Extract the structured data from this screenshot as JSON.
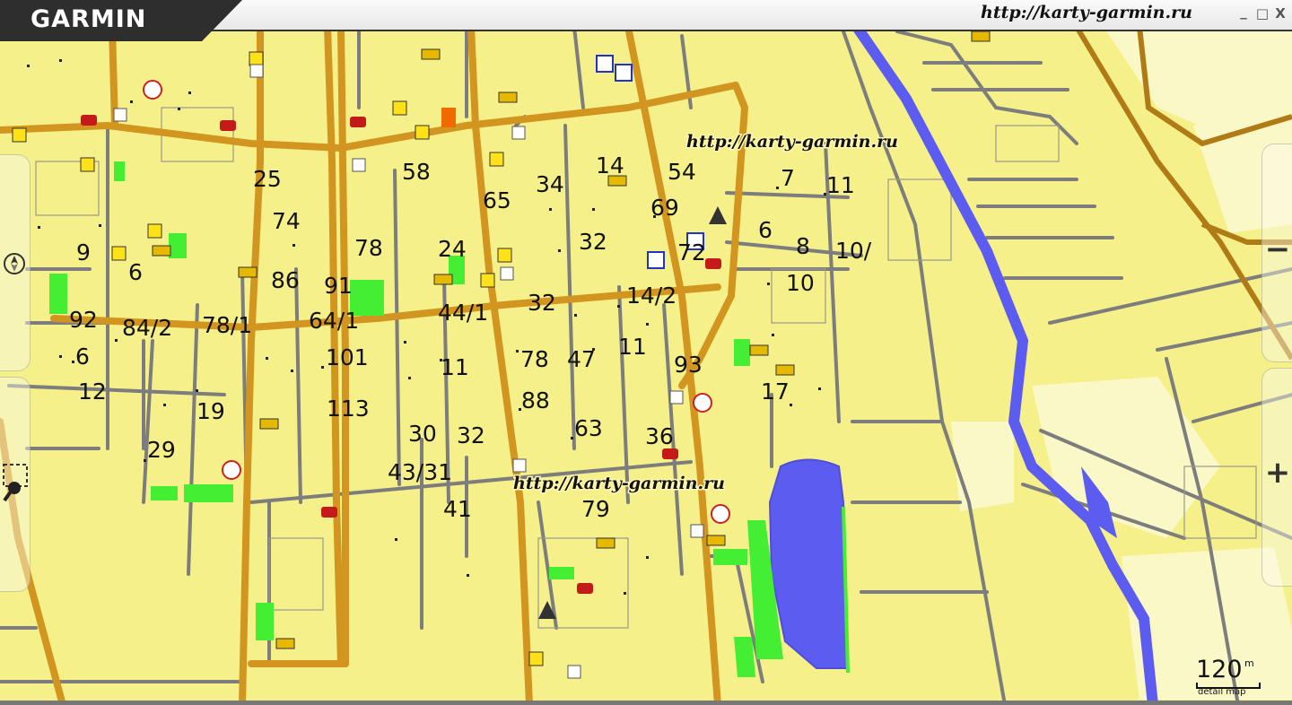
{
  "app": {
    "brand": "GARMIN",
    "site_url": "http://karty-garmin.ru"
  },
  "window": {
    "minimize": "_",
    "maximize": "□",
    "close": "X"
  },
  "watermarks": [
    "http://karty-garmin.ru",
    "http://karty-garmin.ru"
  ],
  "controls": {
    "zoom_in": "+",
    "zoom_out": "−",
    "compass_icon": "compass-icon",
    "search_icon": "zoom-select-icon"
  },
  "scale": {
    "value": "120",
    "unit": "m",
    "detail": "detail map"
  },
  "colors": {
    "land": "#f5f08a",
    "road_major": "#d2951f",
    "road_minor": "#7d7d7d",
    "water": "#5c5cf0",
    "park": "#44ee33",
    "river": "#4455ee"
  },
  "house_numbers": [
    "25",
    "58",
    "34",
    "14",
    "54",
    "7",
    "11",
    "65",
    "69",
    "74",
    "78",
    "24",
    "32",
    "6",
    "8",
    "10/",
    "9",
    "6",
    "72",
    "86",
    "91",
    "10",
    "92",
    "84/2",
    "78/1",
    "64/1",
    "44/1",
    "32",
    "14/2",
    "6",
    "101",
    "78",
    "47",
    "11",
    "93",
    "12",
    "19",
    "113",
    "11",
    "88",
    "17",
    "63",
    "36",
    "29",
    "30",
    "32",
    "43/31",
    "41",
    "79"
  ]
}
